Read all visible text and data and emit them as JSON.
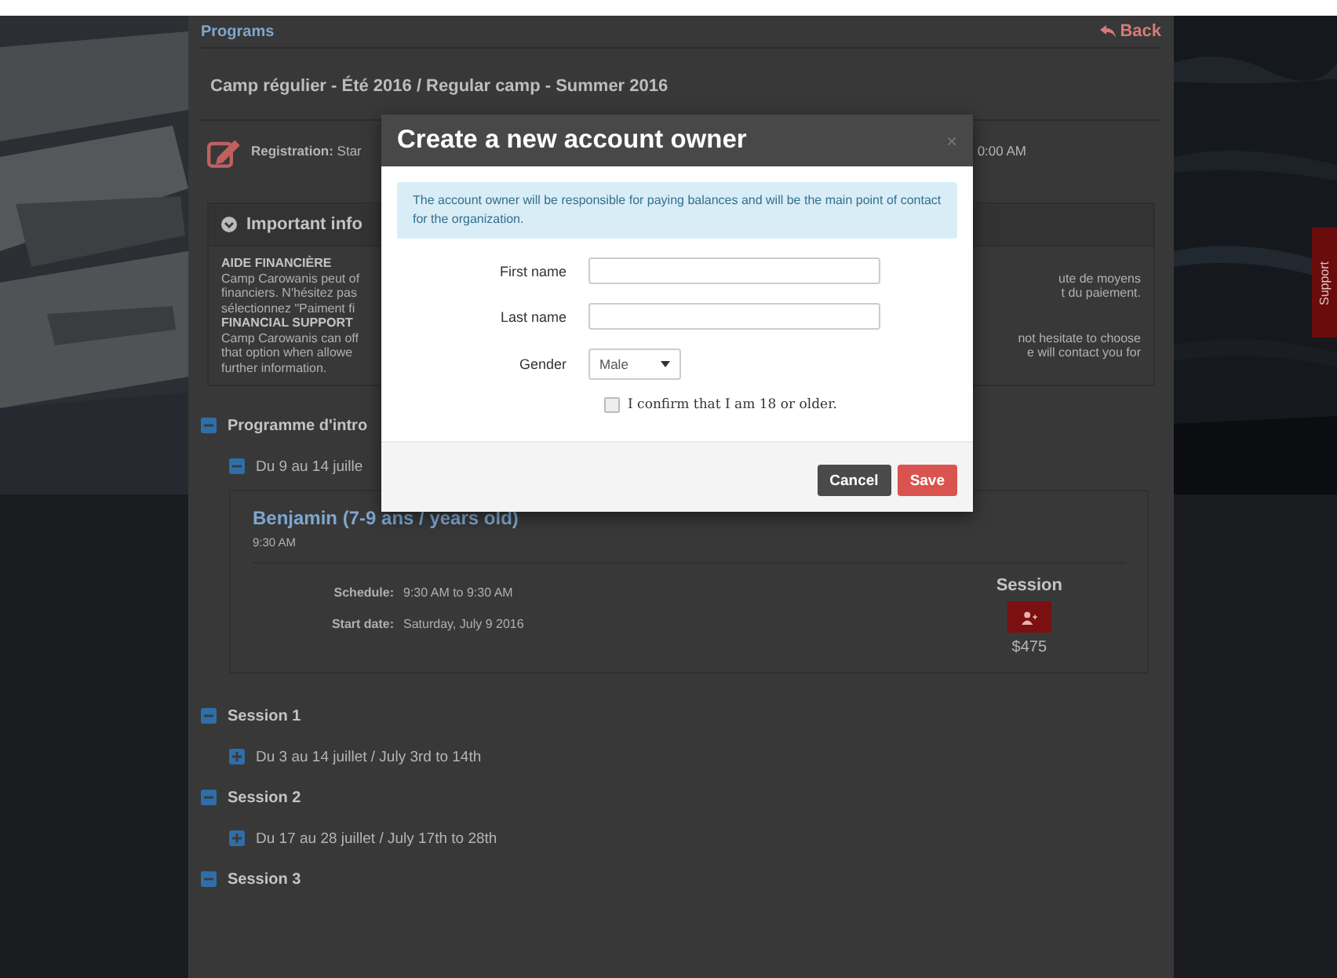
{
  "header": {
    "back_link": "Programs",
    "back_button": "Back",
    "title": "Camp régulier - Été 2016 / Regular camp - Summer 2016",
    "registration_left": "**Registration:** Star",
    "registration_right": "0:00 AM"
  },
  "info": {
    "title": "Important info",
    "sections": [
      {
        "heading": "AIDE FINANCIÈRE",
        "left_lines": [
          "Camp Carowanis peut of",
          "financiers. N'hésitez pas",
          "sélectionnez \"Paiment fi"
        ],
        "right_lines": [
          "ute de moyens",
          "t du paiement."
        ]
      },
      {
        "heading": "FINANCIAL SUPPORT",
        "left_lines": [
          "Camp Carowanis can off",
          "that option when allowe",
          "further information."
        ],
        "right_lines": [
          "not hesitate to choose",
          "e will contact you for"
        ]
      }
    ]
  },
  "tree": [
    {
      "kind": "group",
      "label": "Programme d'intro",
      "expanded": true,
      "children": [
        {
          "kind": "group",
          "label": "Du 9 au 14 juille",
          "expanded": true,
          "children": [
            {
              "kind": "card",
              "title": "Benjamin (7-9 ans / years old)",
              "time": "9:30 AM",
              "details": [
                {
                  "label": "Schedule:",
                  "value": "9:30 AM to 9:30 AM"
                },
                {
                  "label": "Start date:",
                  "value": "Saturday, July 9 2016"
                }
              ],
              "session_label": "Session",
              "price": "$475"
            }
          ]
        }
      ]
    },
    {
      "kind": "group",
      "label": "Session 1",
      "expanded": true,
      "children": [
        {
          "kind": "group",
          "label": "Du 3 au 14 juillet / July 3rd to 14th",
          "expanded": false
        }
      ]
    },
    {
      "kind": "group",
      "label": "Session 2",
      "expanded": true,
      "children": [
        {
          "kind": "group",
          "label": "Du 17 au 28 juillet / July 17th to 28th",
          "expanded": false
        }
      ]
    },
    {
      "kind": "group",
      "label": "Session 3",
      "expanded": true
    }
  ],
  "support_tab": "Support",
  "modal": {
    "title": "Create a new account owner",
    "close": "×",
    "notice": "The account owner will be responsible for paying balances and will be the main point of contact for the organization.",
    "fields": [
      {
        "label": "First name",
        "kind": "text"
      },
      {
        "label": "Last name",
        "kind": "text"
      },
      {
        "label": "Gender",
        "kind": "select",
        "value": "Male"
      }
    ],
    "confirm": {
      "label": "I confirm that I am 18 or older.",
      "checked": false
    },
    "buttons": [
      {
        "label": "Cancel",
        "kind": "secondary"
      },
      {
        "label": "Save",
        "kind": "primary"
      }
    ]
  }
}
